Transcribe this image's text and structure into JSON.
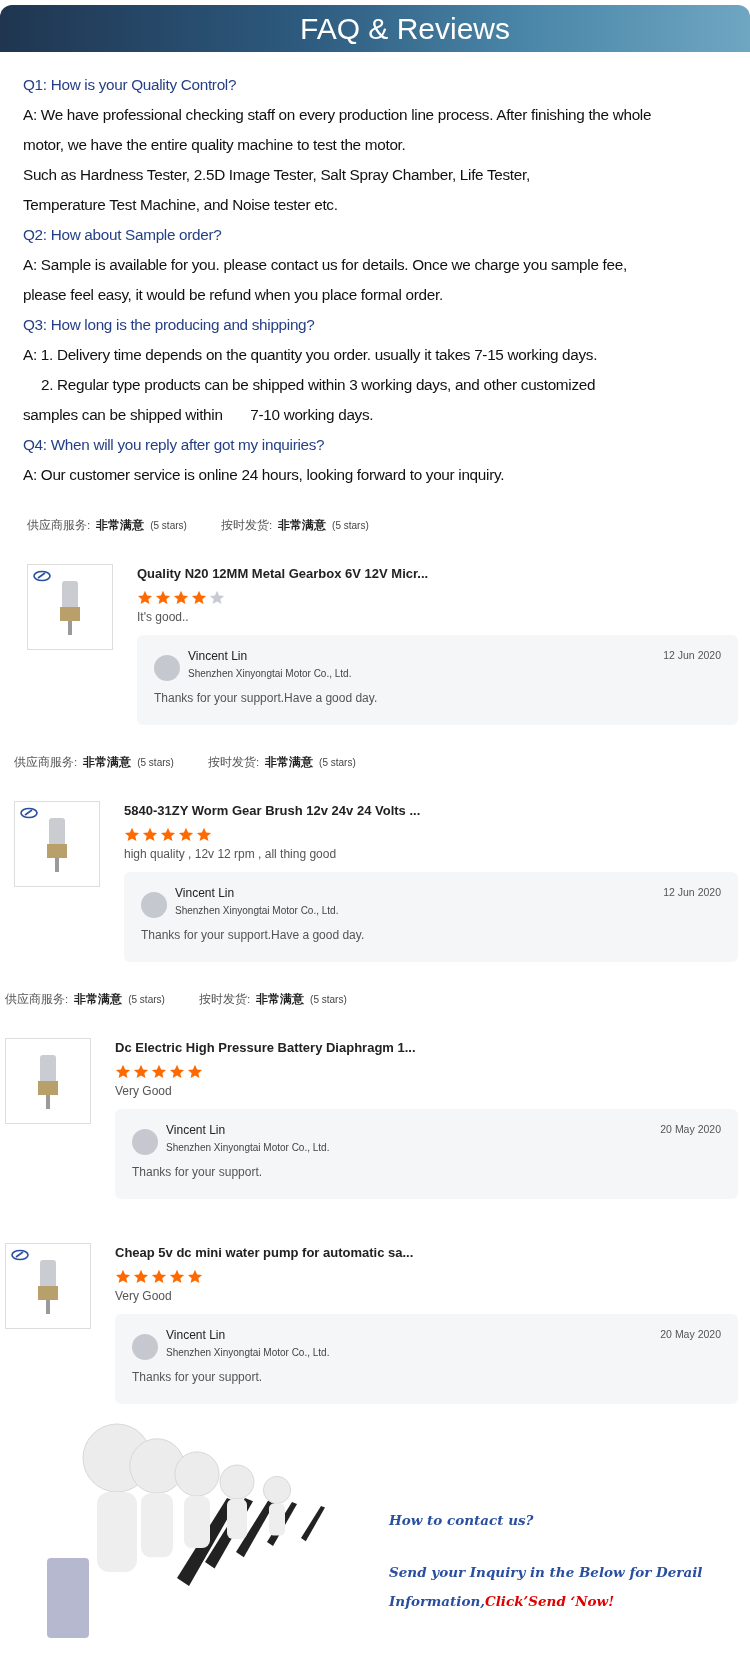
{
  "banner": {
    "title": "FAQ & Reviews"
  },
  "faq": [
    {
      "kind": "question",
      "text": "Q1: How is your Quality Control?"
    },
    {
      "kind": "answer",
      "text": "A: We have professional checking staff on every production line process. After finishing the whole"
    },
    {
      "kind": "answer",
      "text": "motor, we have the entire quality machine to test the motor."
    },
    {
      "kind": "answer",
      "text": "Such as Hardness Tester, 2.5D Image Tester, Salt Spray Chamber, Life Tester,"
    },
    {
      "kind": "answer",
      "text": "Temperature Test Machine, and Noise tester etc."
    },
    {
      "kind": "question",
      "text": "Q2: How about Sample order?"
    },
    {
      "kind": "answer",
      "text": "A: Sample is available for you. please contact us for details. Once we charge you sample fee,"
    },
    {
      "kind": "answer",
      "text": "please feel easy, it would be refund when you place formal order."
    },
    {
      "kind": "question",
      "text": "Q3: How long is the producing and shipping?"
    },
    {
      "kind": "answer",
      "text": "A: 1. Delivery time depends on the quantity you order. usually it takes 7-15 working days."
    },
    {
      "kind": "indent",
      "text": "2. Regular type products can be shipped within 3 working days, and other customized"
    },
    {
      "kind": "answer",
      "text": "samples can be shipped within       7-10 working days."
    },
    {
      "kind": "question",
      "text": "Q4: When will you reply after got my inquiries?"
    },
    {
      "kind": "answer",
      "text": "A: Our customer service is online 24 hours, looking forward to your inquiry."
    }
  ],
  "reviews": [
    {
      "ratings": [
        {
          "label": "供应商服务:",
          "value": "非常满意",
          "note": "(5 stars)"
        },
        {
          "label": "按时发货:",
          "value": "非常满意",
          "note": "(5 stars)"
        }
      ],
      "logo_mark": true,
      "product_title": "Quality N20 12MM Metal Gearbox 6V 12V Micr...",
      "stars": 4,
      "comment": "It's good..",
      "reply": {
        "name": "Vincent Lin",
        "company": "Shenzhen Xinyongtai Motor Co., Ltd.",
        "date": "12 Jun 2020",
        "text": "Thanks for your support.Have a good day."
      }
    },
    {
      "ratings": [
        {
          "label": "供应商服务:",
          "value": "非常满意",
          "note": "(5 stars)"
        },
        {
          "label": "按时发货:",
          "value": "非常满意",
          "note": "(5 stars)"
        }
      ],
      "logo_mark": true,
      "product_title": "5840-31ZY Worm Gear Brush 12v 24v 24 Volts ...",
      "stars": 5,
      "comment": "high quality , 12v 12 rpm , all thing good",
      "reply": {
        "name": "Vincent Lin",
        "company": "Shenzhen Xinyongtai Motor Co., Ltd.",
        "date": "12 Jun 2020",
        "text": "Thanks for your support.Have a good day."
      }
    },
    {
      "ratings": [
        {
          "label": "供应商服务:",
          "value": "非常满意",
          "note": "(5 stars)"
        },
        {
          "label": "按时发货:",
          "value": "非常满意",
          "note": "(5 stars)"
        }
      ],
      "logo_mark": false,
      "product_title": "Dc Electric High Pressure Battery Diaphragm 1...",
      "stars": 5,
      "comment": "Very Good",
      "reply": {
        "name": "Vincent Lin",
        "company": "Shenzhen Xinyongtai Motor Co., Ltd.",
        "date": "20 May 2020",
        "text": "Thanks for your support."
      }
    },
    {
      "logo_mark": true,
      "product_title": "Cheap 5v dc mini water pump for automatic sa...",
      "stars": 5,
      "comment": "Very Good",
      "reply": {
        "name": "Vincent Lin",
        "company": "Shenzhen Xinyongtai Motor Co., Ltd.",
        "date": "20 May 2020",
        "text": "Thanks for your support."
      }
    }
  ],
  "contact": {
    "heading": "How to contact us?",
    "message": [
      {
        "text": "Send your Inquiry in the Below for Derail Information,",
        "highlight": false
      },
      {
        "text": "Click’Send ‘Now!",
        "highlight": true
      }
    ]
  }
}
